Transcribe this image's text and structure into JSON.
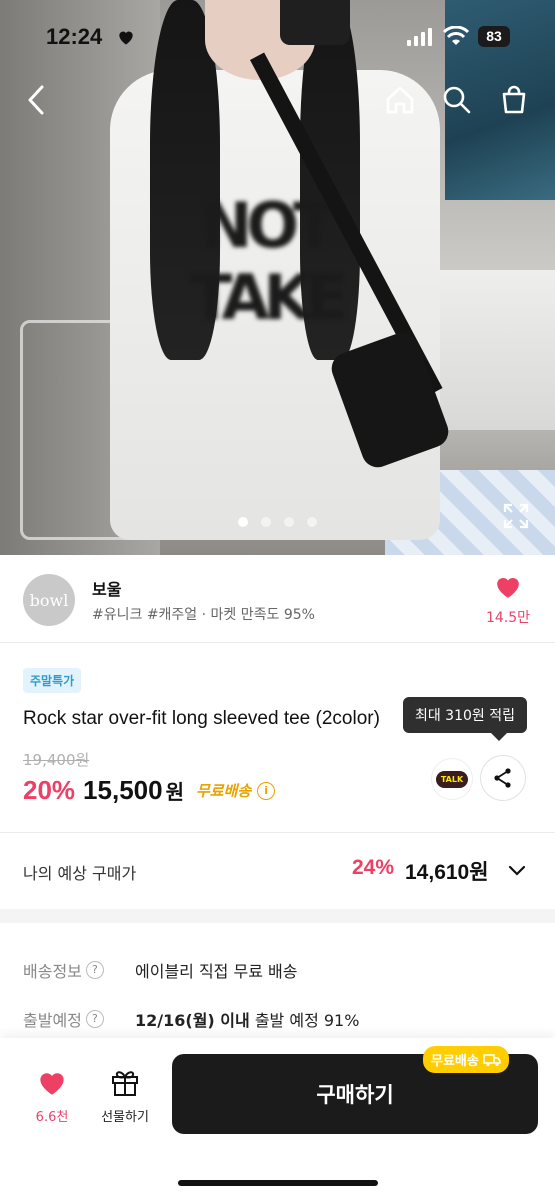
{
  "status": {
    "time": "12:24",
    "battery": "83"
  },
  "hero": {
    "shirt_print": "NOT TAKE",
    "active_slide": 1,
    "slide_count": 4
  },
  "seller": {
    "logo_text": "bowl",
    "name": "보울",
    "tags": "#유니크 #캐주얼 · 마켓 만족도 95%",
    "favorites": "14.5만"
  },
  "product": {
    "badge": "주말특가",
    "name": "Rock star over-fit long sleeved tee (2color)",
    "original_price": "19,400원",
    "discount": "20%",
    "price": "15,500",
    "price_unit": "원",
    "free_shipping": "무료배송",
    "tooltip": "최대 310원 적립",
    "talk_label": "TALK"
  },
  "estimate": {
    "label": "나의 예상 구매가",
    "discount": "24%",
    "price": "14,610원"
  },
  "shipping": {
    "label1": "배송정보",
    "value1": "에이블리 직접 무료 배송",
    "label2": "출발예정",
    "value2_bold": "12/16(월) 이내",
    "value2_rest": " 출발 예정 91%"
  },
  "bottom": {
    "likes": "6.6천",
    "gift_label": "선물하기",
    "buy_label": "구매하기",
    "buy_badge": "무료배송"
  },
  "colors": {
    "accent": "#ee3f65",
    "free_ship": "#e8a300",
    "badge_bg": "#ffcd00"
  }
}
